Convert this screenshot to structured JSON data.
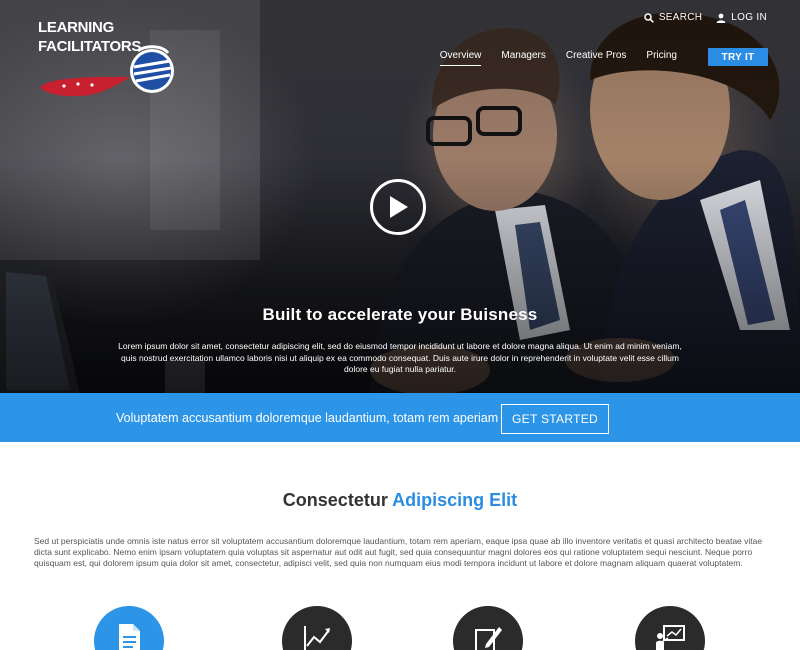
{
  "brand": {
    "line1": "LEARNING",
    "line2": "FACILITATORS",
    "accent_blue": "#2a8de3",
    "accent_red": "#c8202e"
  },
  "utility": {
    "search_label": "SEARCH",
    "login_label": "LOG IN"
  },
  "nav": {
    "items": [
      {
        "label": "Overview",
        "active": true
      },
      {
        "label": "Managers"
      },
      {
        "label": "Creative Pros"
      },
      {
        "label": "Pricing"
      }
    ],
    "cta_label": "TRY IT"
  },
  "hero": {
    "title": "Built to accelerate your Buisness",
    "text": "Lorem ipsum dolor sit amet, consectetur adipiscing elit, sed do eiusmod tempor incididunt ut labore et dolore magna aliqua. Ut enim ad minim veniam, quis nostrud exercitation ullamco laboris nisi ut aliquip ex ea commodo consequat. Duis aute irure dolor in reprehenderit in voluptate velit esse cillum dolore eu fugiat nulla pariatur.",
    "play_icon": "play-icon"
  },
  "banner": {
    "text": "Voluptatem accusantium doloremque laudantium, totam rem aperiam",
    "button_label": "GET STARTED",
    "color": "#2c95e8"
  },
  "section": {
    "title_plain": "Consectetur",
    "title_accent": "Adipiscing Elit",
    "body": "Sed ut perspiciatis unde omnis iste natus error sit voluptatem accusantium doloremque laudantium, totam rem aperiam, eaque ipsa quae ab illo inventore veritatis et quasi architecto beatae vitae dicta sunt explicabo. Nemo enim ipsam voluptatem quia voluptas sit aspernatur aut odit aut fugit, sed quia consequuntur magni dolores eos qui ratione voluptatem sequi nesciunt. Neque porro quisquam est, qui dolorem ipsum quia dolor sit amet, consectetur, adipisci velit, sed quia non numquam eius modi tempora incidunt ut labore et dolore magnam aliquam quaerat voluptatem."
  },
  "features": [
    {
      "icon": "document-icon",
      "color": "#2c95e8"
    },
    {
      "icon": "growth-chart-icon",
      "color": "#2b2b2b"
    },
    {
      "icon": "pen-edit-icon",
      "color": "#2b2b2b"
    },
    {
      "icon": "presentation-icon",
      "color": "#2b2b2b"
    }
  ]
}
